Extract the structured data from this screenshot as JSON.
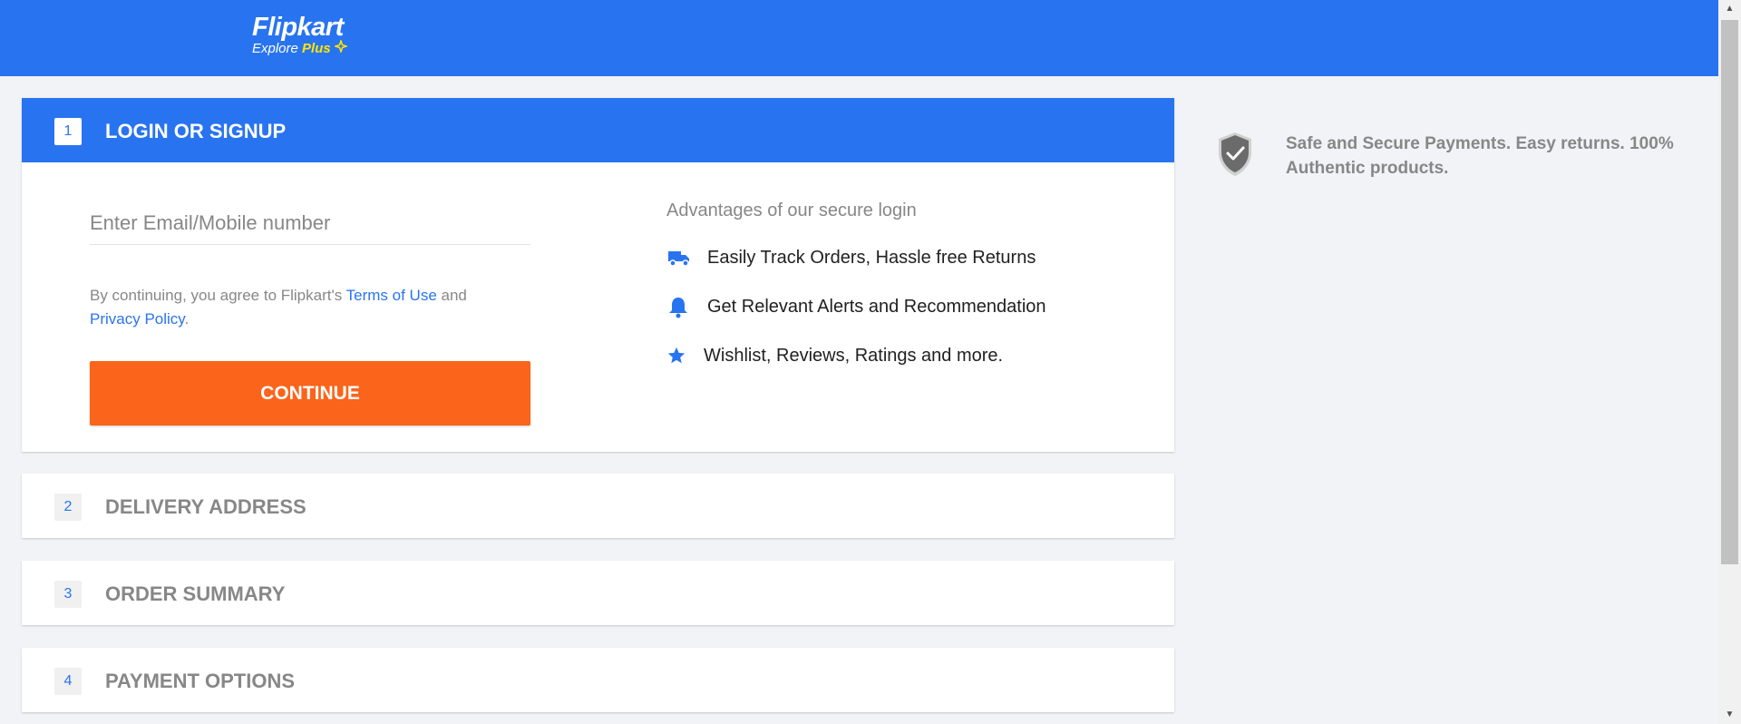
{
  "header": {
    "logo_title": "Flipkart",
    "logo_sub": "Explore",
    "logo_plus": "Plus",
    "brand_color": "#2874f0"
  },
  "steps": [
    {
      "number": "1",
      "title": "LOGIN OR SIGNUP"
    },
    {
      "number": "2",
      "title": "DELIVERY ADDRESS"
    },
    {
      "number": "3",
      "title": "ORDER SUMMARY"
    },
    {
      "number": "4",
      "title": "PAYMENT OPTIONS"
    }
  ],
  "login": {
    "input_placeholder": "Enter Email/Mobile number",
    "input_value": "",
    "terms_prefix": "By continuing, you agree to Flipkart's ",
    "terms_link": "Terms of Use",
    "terms_and": " and",
    "privacy_link": "Privacy Policy",
    "terms_suffix": ".",
    "continue_label": "CONTINUE",
    "continue_color": "#fb641b"
  },
  "advantages": {
    "title": "Advantages of our secure login",
    "items": [
      {
        "icon": "truck-icon",
        "label": "Easily Track Orders, Hassle free Returns"
      },
      {
        "icon": "bell-icon",
        "label": "Get Relevant Alerts and Recommendation"
      },
      {
        "icon": "star-icon",
        "label": "Wishlist, Reviews, Ratings and more."
      }
    ]
  },
  "secure_note": {
    "icon": "shield-check-icon",
    "text": "Safe and Secure Payments. Easy returns. 100% Authentic products."
  }
}
